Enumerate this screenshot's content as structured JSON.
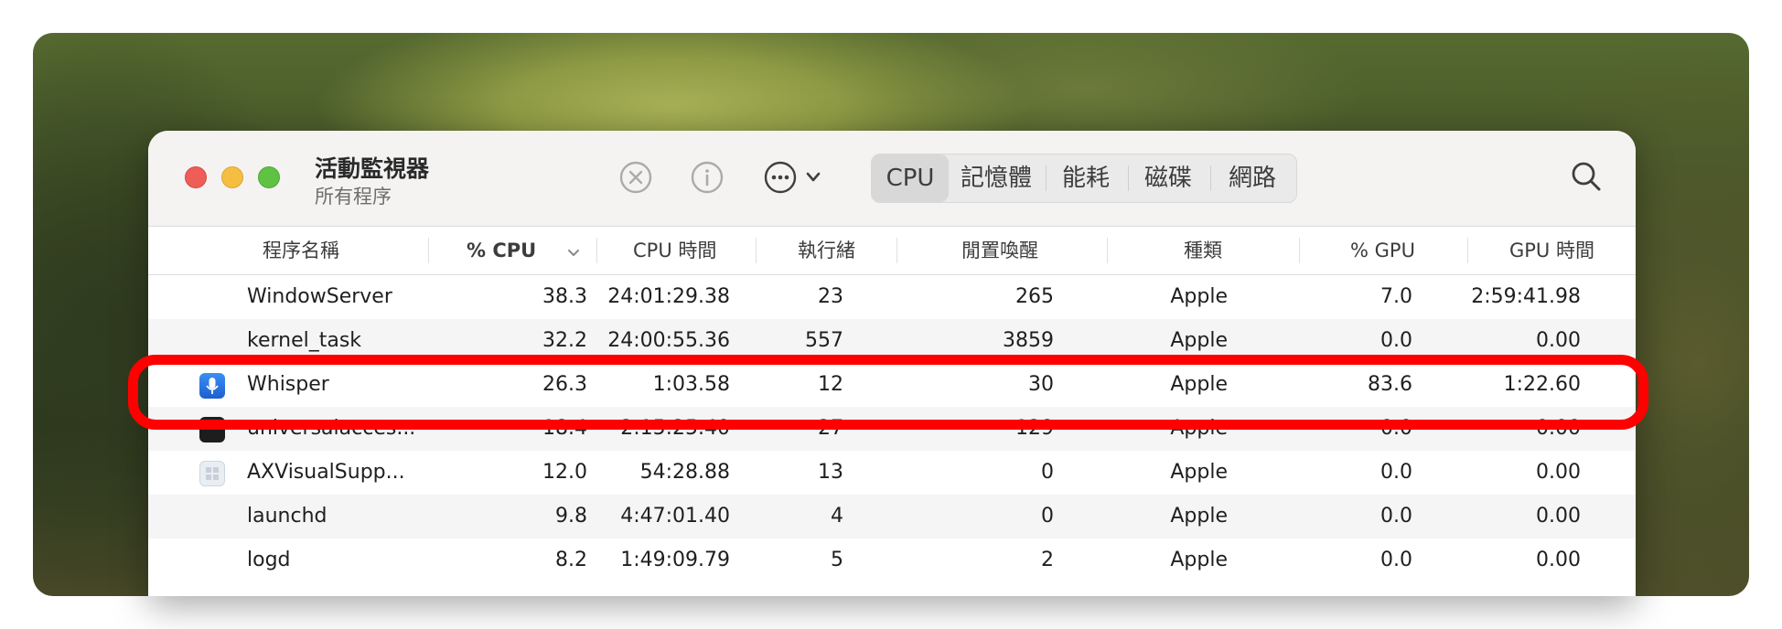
{
  "window": {
    "title": "活動監視器",
    "subtitle": "所有程序"
  },
  "toolbar": {
    "icons": [
      "stop-process-icon",
      "info-icon",
      "more-options-icon",
      "chevron-down-icon",
      "search-icon"
    ],
    "tabs": [
      "CPU",
      "記憶體",
      "能耗",
      "磁碟",
      "網路"
    ],
    "active_tab": "CPU"
  },
  "table": {
    "columns": [
      "程序名稱",
      "% CPU",
      "CPU 時間",
      "執行緒",
      "閒置喚醒",
      "種類",
      "% GPU",
      "GPU 時間"
    ],
    "sort_column": "% CPU",
    "rows": [
      {
        "name": "WindowServer",
        "cpu": "38.3",
        "cpu_time": "24:01:29.38",
        "threads": "23",
        "idle_wake": "265",
        "kind": "Apple",
        "gpu": "7.0",
        "gpu_time": "2:59:41.98",
        "icon": ""
      },
      {
        "name": "kernel_task",
        "cpu": "32.2",
        "cpu_time": "24:00:55.36",
        "threads": "557",
        "idle_wake": "3859",
        "kind": "Apple",
        "gpu": "0.0",
        "gpu_time": "0.00",
        "icon": ""
      },
      {
        "name": "Whisper",
        "cpu": "26.3",
        "cpu_time": "1:03.58",
        "threads": "12",
        "idle_wake": "30",
        "kind": "Apple",
        "gpu": "83.6",
        "gpu_time": "1:22.60",
        "icon": "microphone-app-icon"
      },
      {
        "name": "universalacces...",
        "cpu": "18.4",
        "cpu_time": "2:15:25.40",
        "threads": "27",
        "idle_wake": "129",
        "kind": "Apple",
        "gpu": "0.0",
        "gpu_time": "0.00",
        "icon": "terminal-app-icon"
      },
      {
        "name": "AXVisualSupp...",
        "cpu": "12.0",
        "cpu_time": "54:28.88",
        "threads": "13",
        "idle_wake": "0",
        "kind": "Apple",
        "gpu": "0.0",
        "gpu_time": "0.00",
        "icon": "generic-app-icon"
      },
      {
        "name": "launchd",
        "cpu": "9.8",
        "cpu_time": "4:47:01.40",
        "threads": "4",
        "idle_wake": "0",
        "kind": "Apple",
        "gpu": "0.0",
        "gpu_time": "0.00",
        "icon": ""
      },
      {
        "name": "logd",
        "cpu": "8.2",
        "cpu_time": "1:49:09.79",
        "threads": "5",
        "idle_wake": "2",
        "kind": "Apple",
        "gpu": "0.0",
        "gpu_time": "0.00",
        "icon": ""
      }
    ]
  },
  "annotation": {
    "highlight_color": "#ff0000",
    "highlighted_row": "Whisper"
  },
  "colors": {
    "close": "#ee5e56",
    "minimize": "#f6be40",
    "zoom": "#5fc243"
  }
}
